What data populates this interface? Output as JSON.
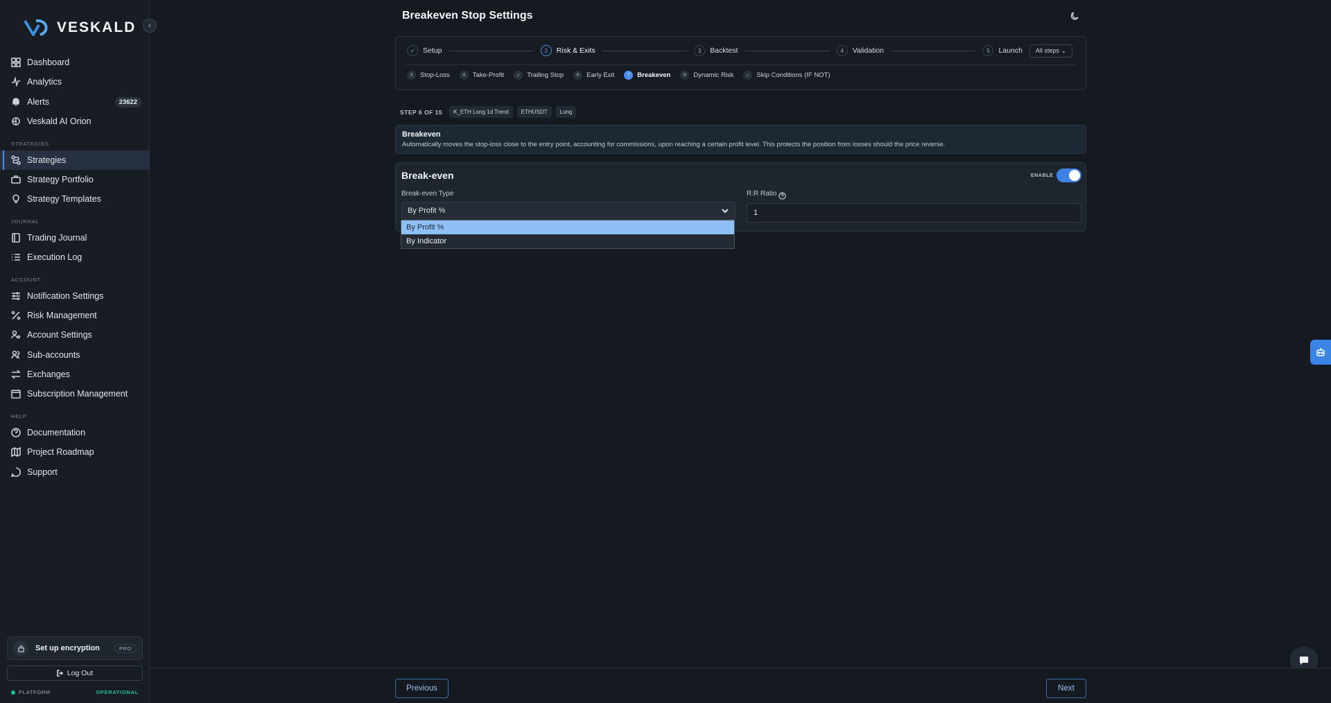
{
  "brand": {
    "name": "VESKALD"
  },
  "sidebar": {
    "items": [
      {
        "label": "Dashboard",
        "icon": "grid-icon"
      },
      {
        "label": "Analytics",
        "icon": "activity-icon"
      },
      {
        "label": "Alerts",
        "icon": "bell-icon",
        "badge": "23622"
      },
      {
        "label": "Veskald AI Orion",
        "icon": "brain-icon"
      }
    ],
    "strategies_label": "STRATEGIES",
    "strategies": [
      {
        "label": "Strategies",
        "icon": "route-icon",
        "active": true
      },
      {
        "label": "Strategy Portfolio",
        "icon": "briefcase-icon"
      },
      {
        "label": "Strategy Templates",
        "icon": "lightbulb-icon"
      }
    ],
    "journal_label": "JOURNAL",
    "journal": [
      {
        "label": "Trading Journal",
        "icon": "book-icon"
      },
      {
        "label": "Execution Log",
        "icon": "list-icon"
      }
    ],
    "account_label": "ACCOUNT",
    "account": [
      {
        "label": "Notification Settings",
        "icon": "sliders-icon"
      },
      {
        "label": "Risk Management",
        "icon": "percent-icon"
      },
      {
        "label": "Account Settings",
        "icon": "user-cog-icon"
      },
      {
        "label": "Sub-accounts",
        "icon": "users-icon"
      },
      {
        "label": "Exchanges",
        "icon": "swap-icon"
      },
      {
        "label": "Subscription Management",
        "icon": "calendar-icon"
      }
    ],
    "help_label": "HELP",
    "help": [
      {
        "label": "Documentation",
        "icon": "help-circle-icon"
      },
      {
        "label": "Project Roadmap",
        "icon": "map-icon"
      },
      {
        "label": "Support",
        "icon": "message-icon"
      }
    ],
    "encryption": {
      "label": "Set up encryption",
      "tag": "PRO"
    },
    "logout_label": "Log Out",
    "platform_label": "PLATFORM",
    "platform_status": "OPERATIONAL"
  },
  "page": {
    "title": "Breakeven Stop Settings"
  },
  "stepper": {
    "steps": [
      {
        "num": "✓",
        "label": "Setup",
        "state": "done"
      },
      {
        "num": "2",
        "label": "Risk & Exits",
        "state": "current"
      },
      {
        "num": "3",
        "label": "Backtest",
        "state": "todo"
      },
      {
        "num": "4",
        "label": "Validation",
        "state": "todo"
      },
      {
        "num": "5",
        "label": "Launch",
        "state": "todo"
      }
    ],
    "all_steps_label": "All steps",
    "substeps": [
      {
        "num": "3",
        "label": "Stop-Loss",
        "state": "todo"
      },
      {
        "num": "4",
        "label": "Take-Profit",
        "state": "todo"
      },
      {
        "num": "✓",
        "label": "Trailing Stop",
        "state": "done"
      },
      {
        "num": "6",
        "label": "Early Exit",
        "state": "todo"
      },
      {
        "num": "7",
        "label": "Breakeven",
        "state": "active"
      },
      {
        "num": "8",
        "label": "Dynamic Risk",
        "state": "todo"
      },
      {
        "num": "✓",
        "label": "Skip Conditions (IF NOT)",
        "state": "done"
      }
    ]
  },
  "meta": {
    "step_counter": "STEP 6 OF 15",
    "chips": [
      "K_ETH Long 1d Trend",
      "ETHUSDT",
      "Long"
    ]
  },
  "info": {
    "title": "Breakeven",
    "description": "Automatically moves the stop-loss close to the entry point, accounting for commissions, upon reaching a certain profit level. This protects the position from losses should the price reverse."
  },
  "breakeven": {
    "title": "Break-even",
    "enable_label": "ENABLE",
    "enabled": true,
    "type_label": "Break-even Type",
    "type_value": "By Profit %",
    "options": [
      "By Profit %",
      "By Indicator"
    ],
    "rr_label": "R:R Ratio",
    "rr_value": "1"
  },
  "footer": {
    "previous_label": "Previous",
    "next_label": "Next"
  },
  "colors": {
    "accent": "#3d82e3",
    "success": "#23c493",
    "background": "#151a21"
  }
}
